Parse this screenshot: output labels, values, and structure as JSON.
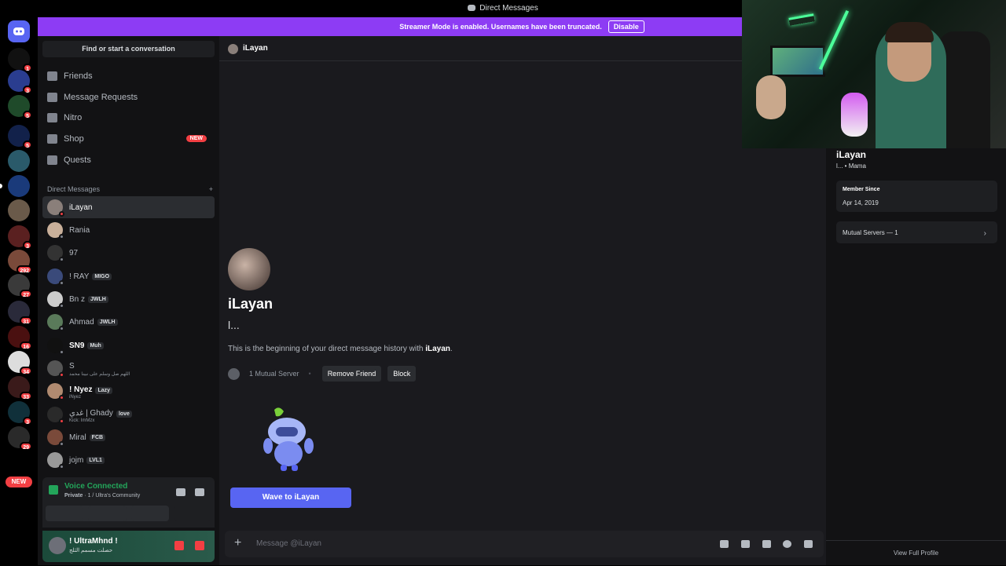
{
  "window": {
    "title": "Direct Messages"
  },
  "banner": {
    "text": "Streamer Mode is enabled. Usernames have been truncated.",
    "disable_label": "Disable"
  },
  "guilds": {
    "badges": [
      "1",
      "3",
      "5",
      "5",
      "3",
      "31",
      "3",
      "292",
      "27",
      "31",
      "16",
      "34",
      "33",
      "3",
      "29"
    ],
    "new_label": "NEW"
  },
  "sidebar": {
    "search_label": "Find or start a conversation",
    "nav": [
      {
        "label": "Friends",
        "icon": "friends-icon"
      },
      {
        "label": "Message Requests",
        "icon": "mail-icon"
      },
      {
        "label": "Nitro",
        "icon": "nitro-icon"
      },
      {
        "label": "Shop",
        "icon": "shop-icon",
        "badge": "NEW"
      },
      {
        "label": "Quests",
        "icon": "quests-icon"
      }
    ],
    "dm_header": "Direct Messages",
    "dm_add": "+",
    "dms": [
      {
        "name": "iLayan",
        "status": "dnd"
      },
      {
        "name": "Rania",
        "status": "offline"
      },
      {
        "name": "97",
        "status": "offline"
      },
      {
        "name": "! RAY",
        "tag": "MIGO",
        "status": "offline"
      },
      {
        "name": "Bn z",
        "tag": "JWLH",
        "status": "offline"
      },
      {
        "name": "Ahmad",
        "tag": "JWLH",
        "status": "offline"
      },
      {
        "name": "SN9",
        "tag": "Muh",
        "status": "offline"
      },
      {
        "name": "S",
        "sub": "اللهم صل وسلم على نبينا محمد",
        "status": "dnd"
      },
      {
        "name": "! Nyez",
        "tag": "Lazy",
        "sub": "iNyez",
        "status": "dnd"
      },
      {
        "name": "غدي | Ghady",
        "tag": "love",
        "sub": "Kick: ImMzx",
        "status": "dnd"
      },
      {
        "name": "Miral",
        "tag": "FCB",
        "status": "offline"
      },
      {
        "name": "jojm",
        "tag": "LVL1",
        "status": "offline"
      }
    ],
    "voice": {
      "title": "Voice Connected",
      "server": "Private",
      "channel": "1 / Ultra's Community"
    },
    "user": {
      "name": "! UltraMhnd !",
      "status": "حصلت مسمم الثلج"
    }
  },
  "chat": {
    "header_name": "iLayan",
    "name": "iLayan",
    "subtitle": "l...",
    "intro_prefix": "This is the beginning of your direct message history with ",
    "intro_name": "iLayan",
    "intro_suffix": ".",
    "mutual_servers": "1 Mutual Server",
    "remove_friend": "Remove Friend",
    "block": "Block",
    "wave_button": "Wave to iLayan",
    "composer_placeholder": "Message @iLayan"
  },
  "profile": {
    "name": "iLayan",
    "subtitle": "l... • Mama",
    "member_since_label": "Member Since",
    "member_since": "Apr 14, 2019",
    "mutual_servers": "Mutual Servers — 1",
    "view_full": "View Full Profile"
  },
  "colors": {
    "accent": "#5865f2",
    "banner": "#8d3cf4",
    "online": "#23a55a",
    "dnd": "#f23f43"
  }
}
